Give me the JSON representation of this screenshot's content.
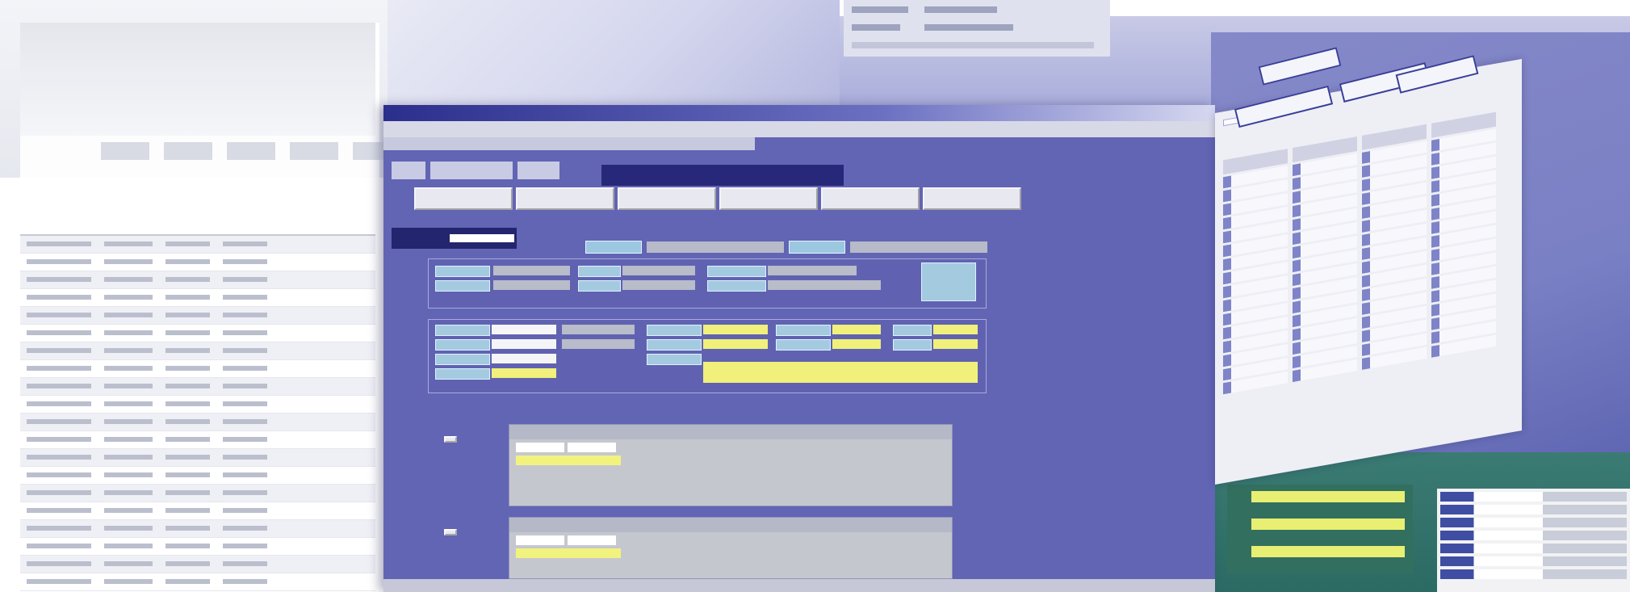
{
  "main_window": {
    "title": "",
    "menu": [
      "",
      "",
      "",
      "",
      ""
    ],
    "tabs": [
      "",
      "",
      ""
    ],
    "screen_title": "",
    "function_buttons": [
      "",
      "",
      "",
      "",
      "",
      ""
    ],
    "code_label": "",
    "sections": [
      "",
      ""
    ]
  },
  "left_report": {
    "columns": [
      "",
      "",
      "",
      "",
      ""
    ],
    "row_count": 20
  },
  "right_window": {
    "toolbar": [
      "",
      ""
    ],
    "columns": [
      "",
      "",
      "",
      ""
    ]
  },
  "colors": {
    "window_bg": "#6264b4",
    "title_block": "#27287a",
    "field_label": "#9cc7e0",
    "field_yellow": "#f0f07a",
    "bottom_panel": "#2c6a64"
  }
}
